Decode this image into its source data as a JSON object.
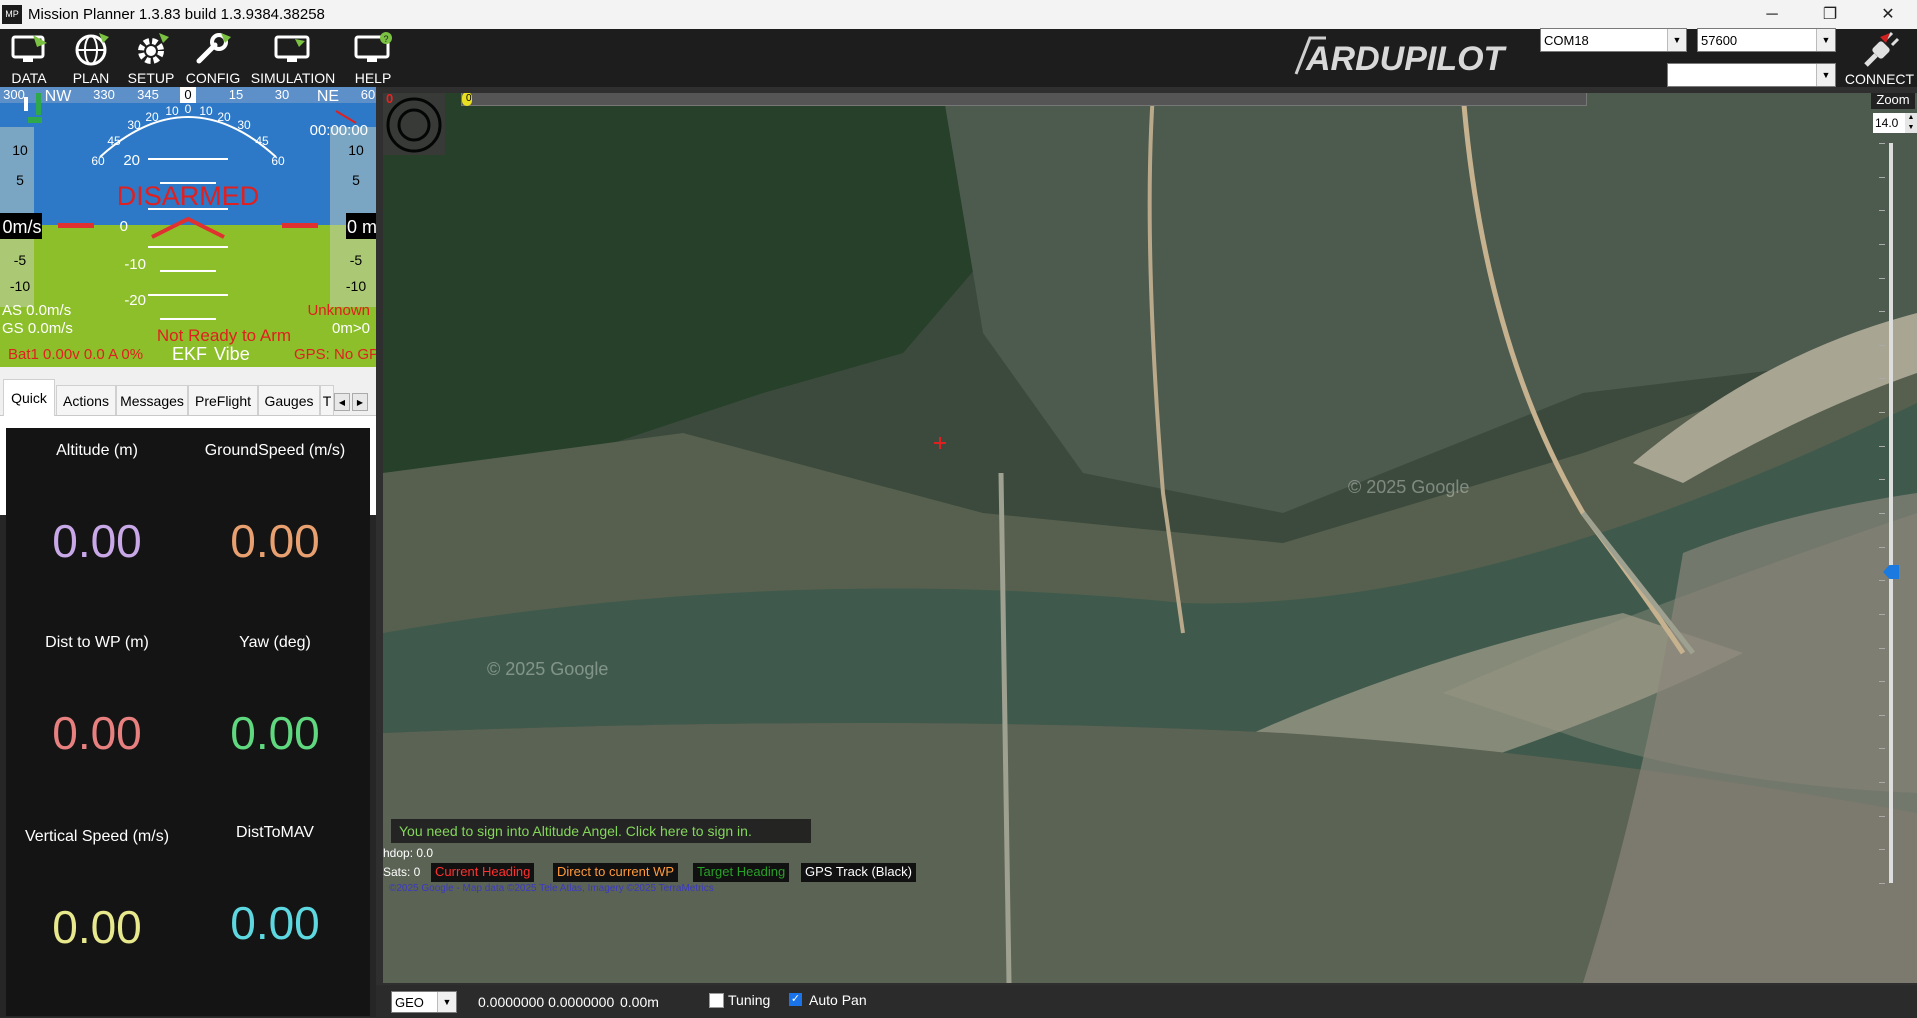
{
  "window": {
    "title": "Mission Planner 1.3.83 build 1.3.9384.38258",
    "app_icon_text": "MP",
    "minimize": "─",
    "restore": "❐",
    "close": "✕"
  },
  "toolbar": {
    "items": [
      {
        "label": "DATA",
        "icon": "data-monitor-icon"
      },
      {
        "label": "PLAN",
        "icon": "globe-icon"
      },
      {
        "label": "SETUP",
        "icon": "gear-icon"
      },
      {
        "label": "CONFIG",
        "icon": "wrench-icon"
      },
      {
        "label": "SIMULATION",
        "icon": "simulation-monitor-icon"
      },
      {
        "label": "HELP",
        "icon": "help-monitor-icon"
      }
    ],
    "logo_text": "ARDUPILOT",
    "port": "COM18",
    "baud": "57600",
    "link": "",
    "connect_label": "CONNECT"
  },
  "hud": {
    "compass": [
      "300",
      "NW",
      "330",
      "345",
      "0",
      "15",
      "30",
      "NE",
      "60"
    ],
    "heading_value": "0",
    "time": "00:00:00",
    "pitch_ladder": [
      "20",
      "0",
      "-10",
      "-20"
    ],
    "roll_scale": [
      "60",
      "45",
      "30",
      "20",
      "10",
      "0",
      "10",
      "20",
      "30",
      "45",
      "60"
    ],
    "left_tape": [
      "10",
      "5",
      "-5",
      "-10"
    ],
    "right_tape": [
      "10",
      "5",
      "-5",
      "-10"
    ],
    "speed": "0m/s",
    "alt": "0 m",
    "armed_state": "DISARMED",
    "airspeed": "AS 0.0m/s",
    "groundspeed": "GS 0.0m/s",
    "mode": "Unknown",
    "dist_home": "0m>0",
    "arm_status": "Not Ready to Arm",
    "battery": "Bat1 0.00v 0.0 A 0%",
    "ekf": "EKF",
    "vibe": "Vibe",
    "gps": "GPS: No GPS",
    "colors": {
      "sky": "#2d79c7",
      "ground": "#8cbf2a",
      "warning": "#e02020"
    }
  },
  "tabs": {
    "items": [
      "Quick",
      "Actions",
      "Messages",
      "PreFlight",
      "Gauges",
      "T"
    ],
    "active": "Quick",
    "scroll_left": "◀",
    "scroll_right": "▶"
  },
  "quick": [
    {
      "label": "Altitude (m)",
      "value": "0.00",
      "color": "#c9a8e8"
    },
    {
      "label": "GroundSpeed (m/s)",
      "value": "0.00",
      "color": "#e8a070"
    },
    {
      "label": "Dist to WP (m)",
      "value": "0.00",
      "color": "#e88080"
    },
    {
      "label": "Yaw (deg)",
      "value": "0.00",
      "color": "#5fd880"
    },
    {
      "label": "Vertical Speed (m/s)",
      "value": "0.00",
      "color": "#e8e88c"
    },
    {
      "label": "DistToMAV",
      "value": "0.00",
      "color": "#5ed8e0"
    }
  ],
  "map": {
    "zoom_label": "Zoom",
    "zoom_value": "14.0",
    "zoom_level": 0.42,
    "slider_value": "0",
    "red_counter": "0",
    "watermark": "© 2025 Google",
    "altitude_angel": "You need to sign into Altitude Angel. Click here to sign in.",
    "hdop": "hdop: 0.0",
    "sats": "Sats: 0",
    "legend": [
      {
        "text": "Current Heading",
        "color": "#ff3030"
      },
      {
        "text": "Direct to current WP",
        "color": "#ff9a3c"
      },
      {
        "text": "Target Heading",
        "color": "#28a028"
      },
      {
        "text": "GPS Track (Black)",
        "color": "#ffffff"
      }
    ],
    "copyright": "©2025 Google - Map data ©2025 Tele Atlas, Imagery ©2025 TerraMetrics"
  },
  "status": {
    "coord_mode": "GEO",
    "coords": "0.0000000 0.0000000",
    "alt": "0.00m",
    "tuning_label": "Tuning",
    "tuning_checked": false,
    "autopan_label": "Auto Pan",
    "autopan_checked": true
  }
}
